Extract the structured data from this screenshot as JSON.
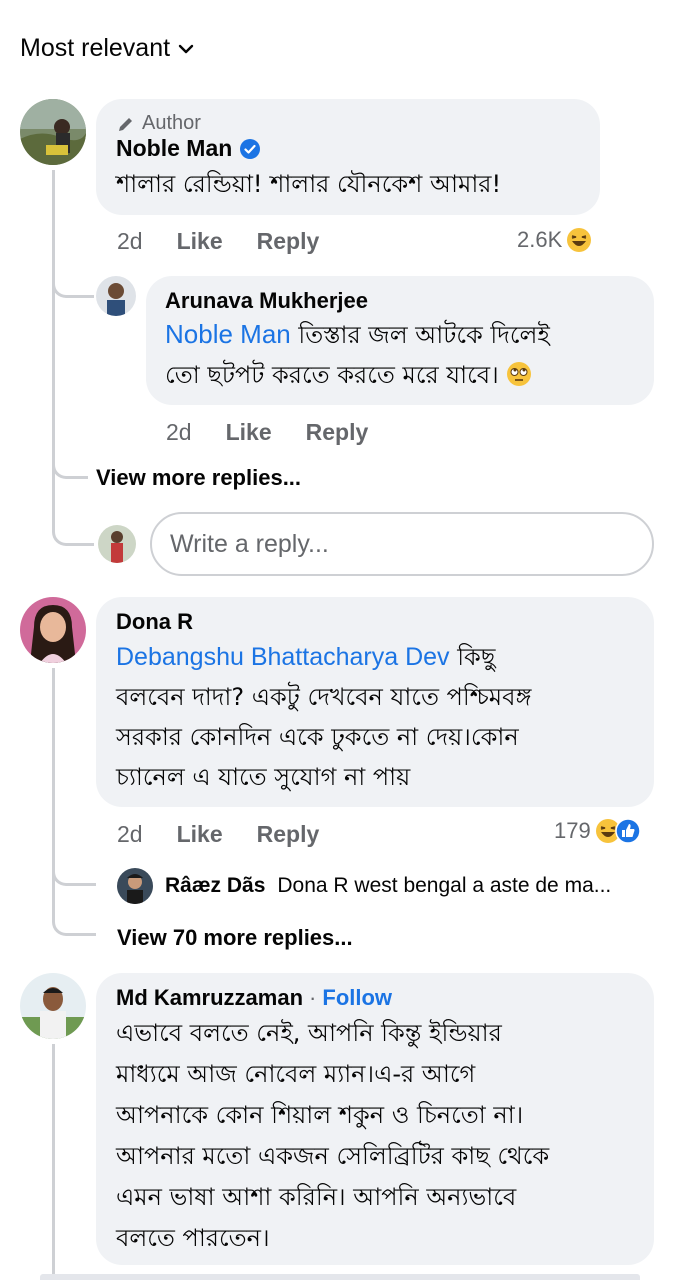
{
  "sort": {
    "label": "Most relevant"
  },
  "comments": [
    {
      "author_badge": "Author",
      "name": "Noble Man",
      "text": "শালার রেন্ডিয়া! শালার যৌনকেশ আমার!",
      "time": "2d",
      "like": "Like",
      "reply": "Reply",
      "reactions": "2.6K",
      "replies": [
        {
          "name": "Arunava Mukherjee",
          "mention": "Noble Man",
          "text_line1": "তিস্তার জল আটকে দিলেই",
          "text_line2": "তো ছটপট করতে করতে মরে যাবে।",
          "time": "2d",
          "like": "Like",
          "reply": "Reply"
        }
      ],
      "view_more": "View more replies...",
      "write_reply_placeholder": "Write a reply..."
    },
    {
      "name": "Dona R",
      "mention": "Debangshu Bhattacharya Dev",
      "text_line1": "কিছু",
      "text_line2": "বলবেন দাদা? একটু দেখবেন যাতে পশ্চিমবঙ্গ",
      "text_line3": "সরকার কোনদিন একে ঢুকতে না দেয়।কোন",
      "text_line4": "চ্যানেল এ যাতে সুযোগ না পায়",
      "time": "2d",
      "like": "Like",
      "reply": "Reply",
      "reactions": "179",
      "preview_reply": {
        "name": "Râæz Dãs",
        "text": "Dona R west bengal a aste de ma..."
      },
      "view_more": "View 70 more replies..."
    },
    {
      "name": "Md Kamruzzaman",
      "separator": "·",
      "follow": "Follow",
      "text_line1": "এভাবে বলতে নেই, আপনি কিন্তু ইন্ডিয়ার",
      "text_line2": "মাধ্যমে আজ নোবেল ম্যান।এ-র আগে",
      "text_line3": "আপনাকে কোন শিয়াল শকুন ও চিনতো না।",
      "text_line4": "আপনার মতো একজন সেলিব্রিটির কাছ থেকে",
      "text_line5": "এমন ভাষা আশা করিনি। আপনি অন্যভাবে",
      "text_line6": "বলতে পারতেন।"
    }
  ],
  "colors": {
    "link": "#1b74e4",
    "bubble": "#f0f2f5",
    "muted": "#65676b",
    "line": "#ced0d4"
  }
}
